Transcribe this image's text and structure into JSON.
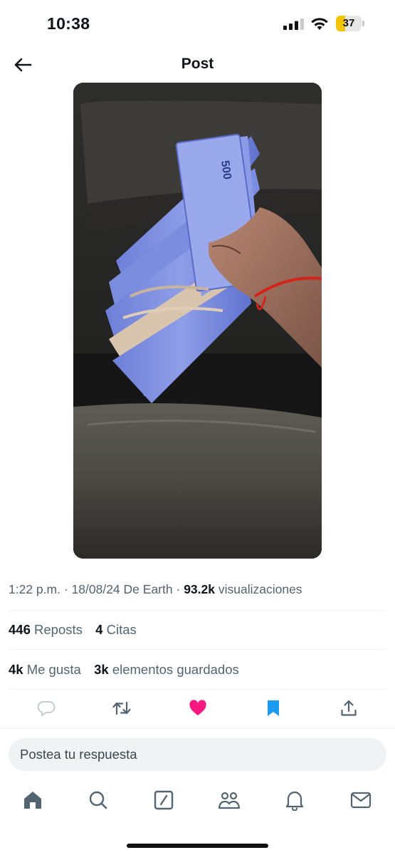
{
  "status_bar": {
    "time": "10:38",
    "battery_level": "37",
    "battery_color": "#f5c400"
  },
  "header": {
    "title": "Post",
    "back_icon": "arrow-left-icon"
  },
  "post": {
    "time": "1:22 p.m.",
    "date": "18/08/24",
    "source": "De Earth",
    "views_count": "93.2k",
    "views_label": "visualizaciones",
    "reposts_count": "446",
    "reposts_label": "Reposts",
    "quotes_count": "4",
    "quotes_label": "Citas",
    "likes_count": "4k",
    "likes_label": "Me gusta",
    "bookmarks_count": "3k",
    "bookmarks_label": "elementos guardados"
  },
  "actions": {
    "reply_icon": "reply-icon",
    "repost_icon": "repost-icon",
    "like_icon": "heart-icon",
    "like_color": "#f91880",
    "bookmark_icon": "bookmark-icon",
    "bookmark_color": "#1d9bf0",
    "share_icon": "share-icon"
  },
  "reply": {
    "placeholder": "Postea tu respuesta"
  },
  "tabbar": {
    "items": [
      "home-icon",
      "search-icon",
      "grok-icon",
      "communities-icon",
      "notifications-icon",
      "messages-icon"
    ]
  }
}
